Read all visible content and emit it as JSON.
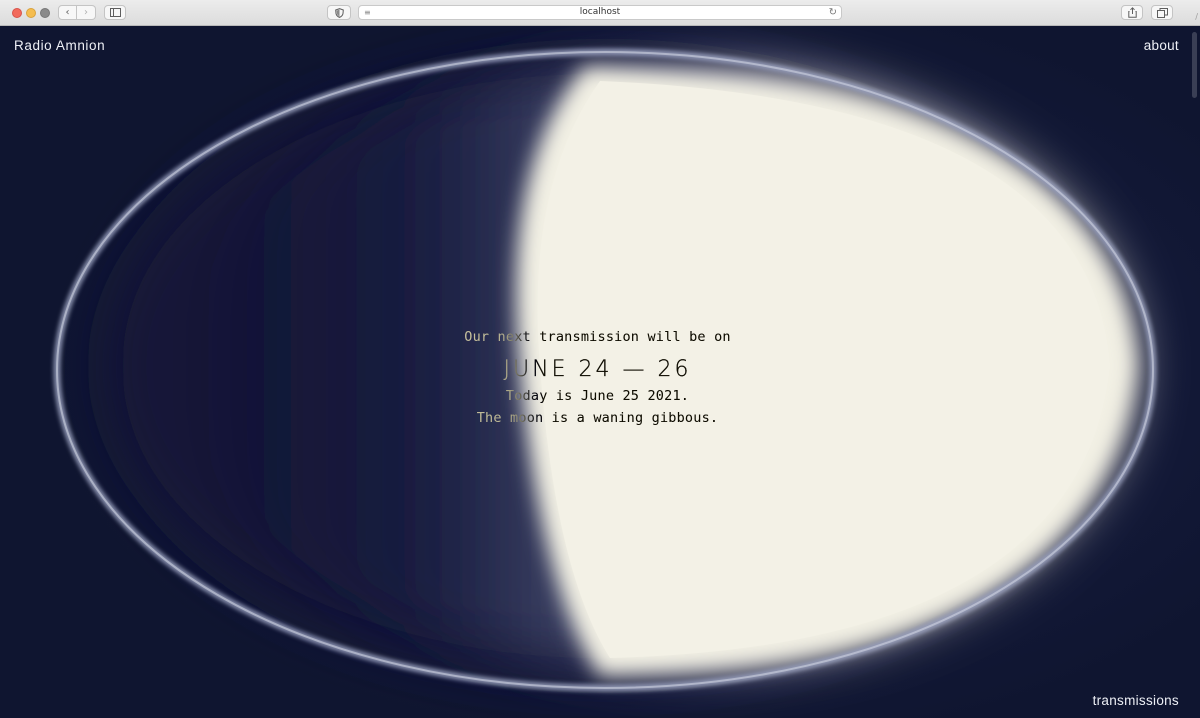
{
  "browser": {
    "url": "localhost",
    "icons": {
      "back": "chevron-left-icon",
      "forward": "chevron-right-icon",
      "sidebar": "sidebar-icon",
      "privacy": "shield-icon",
      "reader": "reader-icon",
      "reload": "reload-icon",
      "share": "share-icon",
      "tabs": "tabs-icon"
    }
  },
  "header": {
    "site_title": "Radio Amnion",
    "about_label": "about"
  },
  "announcement": {
    "intro": "Our next transmission will be on",
    "dates": "JUNE 24 — 26",
    "today": "Today is June 25 2021.",
    "moon_phase": "The moon is a waning gibbous."
  },
  "footer": {
    "transmissions_label": "transmissions"
  },
  "colors": {
    "background": "#0f1530",
    "moon": "#f2f0e4",
    "text": "#eef0f6"
  }
}
